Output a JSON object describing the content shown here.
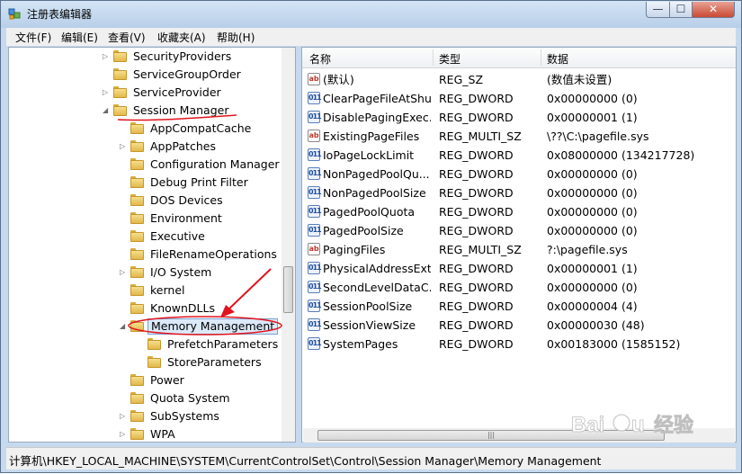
{
  "window": {
    "title": "注册表编辑器",
    "minimize": "—",
    "maximize": "☐",
    "close": "✕"
  },
  "menu": [
    "文件(F)",
    "编辑(E)",
    "查看(V)",
    "收藏夹(A)",
    "帮助(H)"
  ],
  "tree": [
    {
      "label": "SecurityProviders",
      "expander": "▷"
    },
    {
      "label": "ServiceGroupOrder",
      "expander": ""
    },
    {
      "label": "ServiceProvider",
      "expander": "▷"
    },
    {
      "label": "Session Manager",
      "expander": "◢"
    },
    {
      "label": "AppCompatCache",
      "expander": ""
    },
    {
      "label": "AppPatches",
      "expander": "▷"
    },
    {
      "label": "Configuration Manager",
      "expander": ""
    },
    {
      "label": "Debug Print Filter",
      "expander": ""
    },
    {
      "label": "DOS Devices",
      "expander": ""
    },
    {
      "label": "Environment",
      "expander": ""
    },
    {
      "label": "Executive",
      "expander": ""
    },
    {
      "label": "FileRenameOperations",
      "expander": ""
    },
    {
      "label": "I/O System",
      "expander": "▷"
    },
    {
      "label": "kernel",
      "expander": ""
    },
    {
      "label": "KnownDLLs",
      "expander": ""
    },
    {
      "label": "Memory Management",
      "expander": "◢",
      "selected": true
    },
    {
      "label": "PrefetchParameters",
      "expander": ""
    },
    {
      "label": "StoreParameters",
      "expander": ""
    },
    {
      "label": "Power",
      "expander": ""
    },
    {
      "label": "Quota System",
      "expander": ""
    },
    {
      "label": "SubSystems",
      "expander": "▷"
    },
    {
      "label": "WPA",
      "expander": "▷"
    }
  ],
  "list": {
    "columns": [
      "名称",
      "类型",
      "数据"
    ],
    "rows": [
      {
        "icon": "ab",
        "name": "(默认)",
        "type": "REG_SZ",
        "data": "(数值未设置)"
      },
      {
        "icon": "bin",
        "name": "ClearPageFileAtShu...",
        "type": "REG_DWORD",
        "data": "0x00000000 (0)"
      },
      {
        "icon": "bin",
        "name": "DisablePagingExec...",
        "type": "REG_DWORD",
        "data": "0x00000001 (1)"
      },
      {
        "icon": "ab",
        "name": "ExistingPageFiles",
        "type": "REG_MULTI_SZ",
        "data": "\\??\\C:\\pagefile.sys"
      },
      {
        "icon": "bin",
        "name": "IoPageLockLimit",
        "type": "REG_DWORD",
        "data": "0x08000000 (134217728)"
      },
      {
        "icon": "bin",
        "name": "NonPagedPoolQu...",
        "type": "REG_DWORD",
        "data": "0x00000000 (0)"
      },
      {
        "icon": "bin",
        "name": "NonPagedPoolSize",
        "type": "REG_DWORD",
        "data": "0x00000000 (0)"
      },
      {
        "icon": "bin",
        "name": "PagedPoolQuota",
        "type": "REG_DWORD",
        "data": "0x00000000 (0)"
      },
      {
        "icon": "bin",
        "name": "PagedPoolSize",
        "type": "REG_DWORD",
        "data": "0x00000000 (0)"
      },
      {
        "icon": "ab",
        "name": "PagingFiles",
        "type": "REG_MULTI_SZ",
        "data": "?:\\pagefile.sys"
      },
      {
        "icon": "bin",
        "name": "PhysicalAddressExt...",
        "type": "REG_DWORD",
        "data": "0x00000001 (1)"
      },
      {
        "icon": "bin",
        "name": "SecondLevelDataC...",
        "type": "REG_DWORD",
        "data": "0x00000000 (0)"
      },
      {
        "icon": "bin",
        "name": "SessionPoolSize",
        "type": "REG_DWORD",
        "data": "0x00000004 (4)"
      },
      {
        "icon": "bin",
        "name": "SessionViewSize",
        "type": "REG_DWORD",
        "data": "0x00000030 (48)"
      },
      {
        "icon": "bin",
        "name": "SystemPages",
        "type": "REG_DWORD",
        "data": "0x00183000 (1585152)"
      }
    ]
  },
  "status": "计算机\\HKEY_LOCAL_MACHINE\\SYSTEM\\CurrentControlSet\\Control\\Session Manager\\Memory Management",
  "watermark": "Baidu 经验",
  "colors": {
    "annotation": "#e0141e",
    "selection": "#dbe9f9"
  }
}
